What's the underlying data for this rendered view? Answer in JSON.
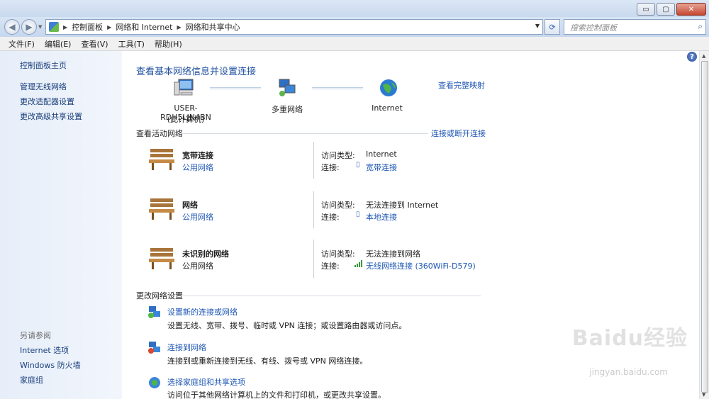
{
  "window": {
    "minimize": "▭",
    "maximize": "▢",
    "close": "✕"
  },
  "nav": {
    "breadcrumb": [
      "控制面板",
      "网络和 Internet",
      "网络和共享中心"
    ],
    "search_placeholder": "搜索控制面板"
  },
  "menu": [
    "文件(F)",
    "编辑(E)",
    "查看(V)",
    "工具(T)",
    "帮助(H)"
  ],
  "sidebar": {
    "home": "控制面板主页",
    "items": [
      "管理无线网络",
      "更改适配器设置",
      "更改高级共享设置"
    ],
    "see_also_title": "另请参阅",
    "see_also": [
      "Internet 选项",
      "Windows 防火墙",
      "家庭组"
    ]
  },
  "main": {
    "title": "查看基本网络信息并设置连接",
    "view_full_map": "查看完整映射",
    "map": {
      "computer_name": "USER-RDH5LJN4BN",
      "computer_sub": "(此计算机)",
      "network": "多重网络",
      "internet": "Internet"
    },
    "active_title": "查看活动网络",
    "connect_disconnect": "连接或断开连接",
    "access_type_label": "访问类型:",
    "connection_label": "连接:",
    "networks": [
      {
        "name": "宽带连接",
        "category": "公用网络",
        "category_link": true,
        "access": "Internet",
        "connection": "宽带连接",
        "conn_icon": "modem-icon"
      },
      {
        "name": "网络",
        "category": "公用网络",
        "category_link": true,
        "access": "无法连接到 Internet",
        "connection": "本地连接",
        "conn_icon": "ethernet-icon"
      },
      {
        "name": "未识别的网络",
        "category": "公用网络",
        "category_link": false,
        "access": "无法连接到网络",
        "connection": "无线网络连接 (360WiFi-D579)",
        "conn_icon": "signal-bars-icon"
      }
    ],
    "change_title": "更改网络设置",
    "tasks": [
      {
        "link": "设置新的连接或网络",
        "desc": "设置无线、宽带、拨号、临时或 VPN 连接；或设置路由器或访问点。"
      },
      {
        "link": "连接到网络",
        "desc": "连接到或重新连接到无线、有线、拨号或 VPN 网络连接。"
      },
      {
        "link": "选择家庭组和共享选项",
        "desc": "访问位于其他网络计算机上的文件和打印机，或更改共享设置。"
      }
    ]
  },
  "watermark": {
    "brand": "Baidu经验",
    "url": "jingyan.baidu.com"
  },
  "colors": {
    "link": "#1e56b4",
    "title": "#1e4f9e",
    "sidebar_bg": "#e6eef9"
  }
}
